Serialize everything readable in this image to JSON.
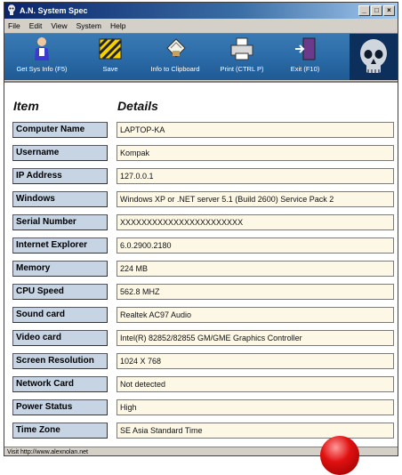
{
  "window": {
    "title": "A.N. System Spec"
  },
  "titlebar_buttons": {
    "minimize": "_",
    "maximize": "□",
    "close": "×"
  },
  "menu": [
    "File",
    "Edit",
    "View",
    "System",
    "Help"
  ],
  "toolbar": {
    "items": [
      {
        "label": "Get Sys Info (F5)",
        "icon": "person-info-icon"
      },
      {
        "label": "Save",
        "icon": "save-icon"
      },
      {
        "label": "Info to Clipboard",
        "icon": "clipboard-icon"
      },
      {
        "label": "Print (CTRL P)",
        "icon": "printer-icon"
      },
      {
        "label": "Exit (F10)",
        "icon": "exit-door-icon"
      }
    ],
    "logo_icon": "skull-icon"
  },
  "headers": {
    "item": "Item",
    "details": "Details"
  },
  "rows": [
    {
      "label": "Computer Name",
      "value": "LAPTOP-KA"
    },
    {
      "label": "Username",
      "value": "Kompak"
    },
    {
      "label": "IP Address",
      "value": "127.0.0.1"
    },
    {
      "label": "Windows",
      "value": "Windows XP or .NET server 5.1 (Build 2600) Service Pack 2"
    },
    {
      "label": "Serial Number",
      "value": "XXXXXXXXXXXXXXXXXXXXXXX"
    },
    {
      "label": "Internet Explorer",
      "value": "6.0.2900.2180"
    },
    {
      "label": "Memory",
      "value": "224 MB"
    },
    {
      "label": "CPU Speed",
      "value": "562.8 MHZ"
    },
    {
      "label": "Sound card",
      "value": "Realtek AC97 Audio"
    },
    {
      "label": "Video card",
      "value": "Intel(R) 82852/82855 GM/GME Graphics Controller"
    },
    {
      "label": "Screen Resolution",
      "value": "1024 X 768"
    },
    {
      "label": "Network Card",
      "value": "Not detected"
    },
    {
      "label": "Power Status",
      "value": "High"
    },
    {
      "label": "Time Zone",
      "value": "SE Asia Standard Time"
    }
  ],
  "status": {
    "text": "Visit http://www.alexnolan.net"
  },
  "colors": {
    "toolbar_blue": "#2a6aa6",
    "label_bg": "#c6d4e4",
    "value_bg": "#fdf8e6",
    "title_blue": "#0a246a"
  }
}
